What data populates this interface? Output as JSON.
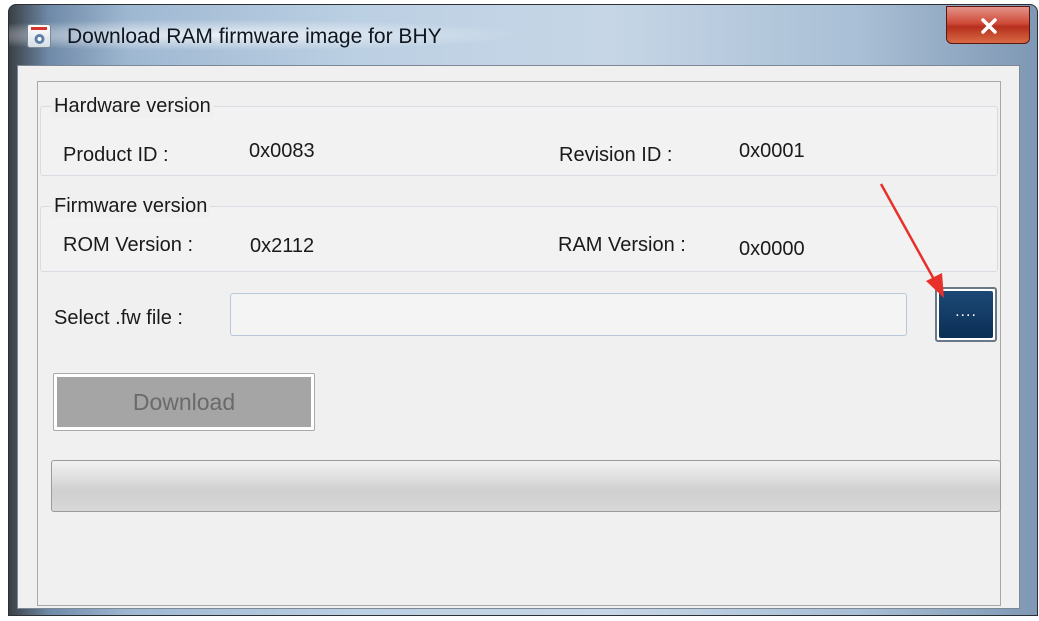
{
  "window": {
    "title": "Download RAM firmware image for BHY",
    "title_icon": "app-window-icon",
    "close_icon": "close-icon"
  },
  "hardware": {
    "title": "Hardware version",
    "product_id_label": "Product ID :",
    "product_id_value": "0x0083",
    "revision_id_label": "Revision ID :",
    "revision_id_value": "0x0001"
  },
  "firmware": {
    "title": "Firmware version",
    "rom_label": "ROM Version :",
    "rom_value": "0x2112",
    "ram_label": "RAM Version :",
    "ram_value": "0x0000"
  },
  "file_select": {
    "label": "Select .fw file :",
    "value": "",
    "placeholder": "",
    "browse_label": "...."
  },
  "download": {
    "label": "Download",
    "enabled": false
  },
  "progress": {
    "percent": 0
  },
  "colors": {
    "browse_button": "#0b2f55",
    "download_button_disabled": "#a5a5a5",
    "annotation_arrow": "#e8302a",
    "close_button": "#c8402e"
  }
}
